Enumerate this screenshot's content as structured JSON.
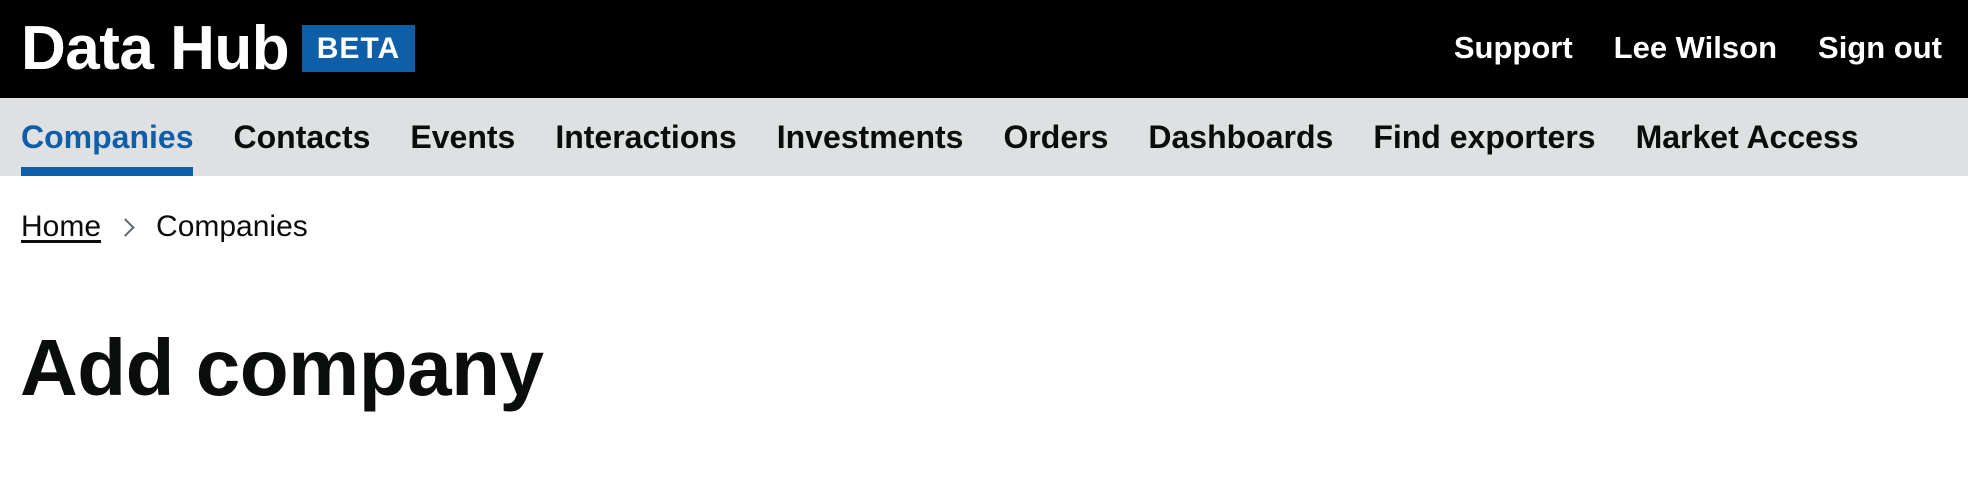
{
  "header": {
    "logo": "Data Hub",
    "badge": "BETA",
    "links": [
      "Support",
      "Lee Wilson",
      "Sign out"
    ]
  },
  "nav": {
    "items": [
      "Companies",
      "Contacts",
      "Events",
      "Interactions",
      "Investments",
      "Orders",
      "Dashboards",
      "Find exporters",
      "Market Access"
    ],
    "active": "Companies"
  },
  "breadcrumb": {
    "home": "Home",
    "current": "Companies"
  },
  "page": {
    "title": "Add company"
  },
  "colors": {
    "brand_blue": "#0f5ea8",
    "header_bg": "#000000",
    "nav_bg": "#dee0e2"
  }
}
